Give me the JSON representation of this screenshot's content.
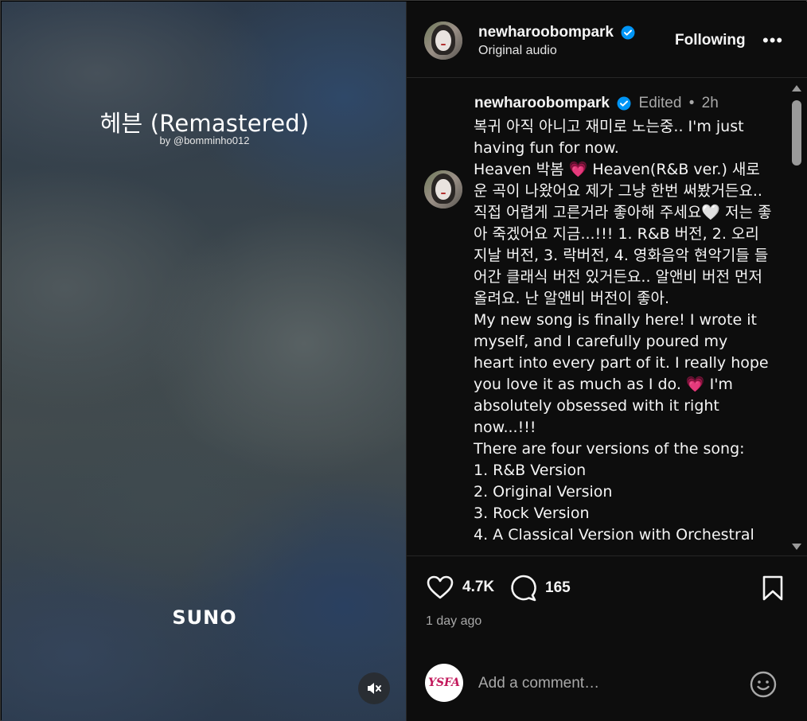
{
  "media": {
    "song_title": "헤븐 (Remastered)",
    "song_by": "by @bomminho012",
    "brand": "SUNO",
    "mute_icon": "speaker-muted-icon"
  },
  "header": {
    "username": "newharoobompark",
    "subtitle": "Original audio",
    "follow_label": "Following",
    "more_label": "•••"
  },
  "post": {
    "username": "newharoobompark",
    "edited": "Edited",
    "dot": "•",
    "time": "2h",
    "caption_lines": [
      "복귀 아직 아니고 재미로 노는중.. I'm just having fun for now.",
      "Heaven 박봄 💗 Heaven(R&B ver.) 새로운 곡이 나왔어요 제가 그냥 한번 써봤거든요.. 직접 어렵게 고른거라 좋아해 주세요🤍 저는 좋아 죽겠어요 지금...!!! 1. R&B 버전, 2. 오리지날 버전, 3. 락버전, 4. 영화음악 현악기들 들어간 클래식 버전 있거든요.. 알앤비 버전 먼저 올려요. 난 알앤비 버전이 좋아.",
      "My new song is finally here! I wrote it myself, and I carefully poured my heart into every part of it. I really hope you love it as much as I do. 💗 I'm absolutely obsessed with it right now...!!!",
      "There are four versions of the song:",
      "1. R&B Version",
      "2. Original Version",
      "3. Rock Version",
      "4. A Classical Version with Orchestral"
    ]
  },
  "actions": {
    "likes": "4.7K",
    "comments": "165",
    "time_ago": "1 day ago"
  },
  "comment_box": {
    "avatar_text": "YSFA",
    "placeholder": "Add a comment…"
  },
  "colors": {
    "background": "#000000",
    "panel": "#0d0d0d",
    "verified": "#0095f6",
    "muted_text": "#a8a8a8",
    "heart": "#ff3b6a"
  }
}
